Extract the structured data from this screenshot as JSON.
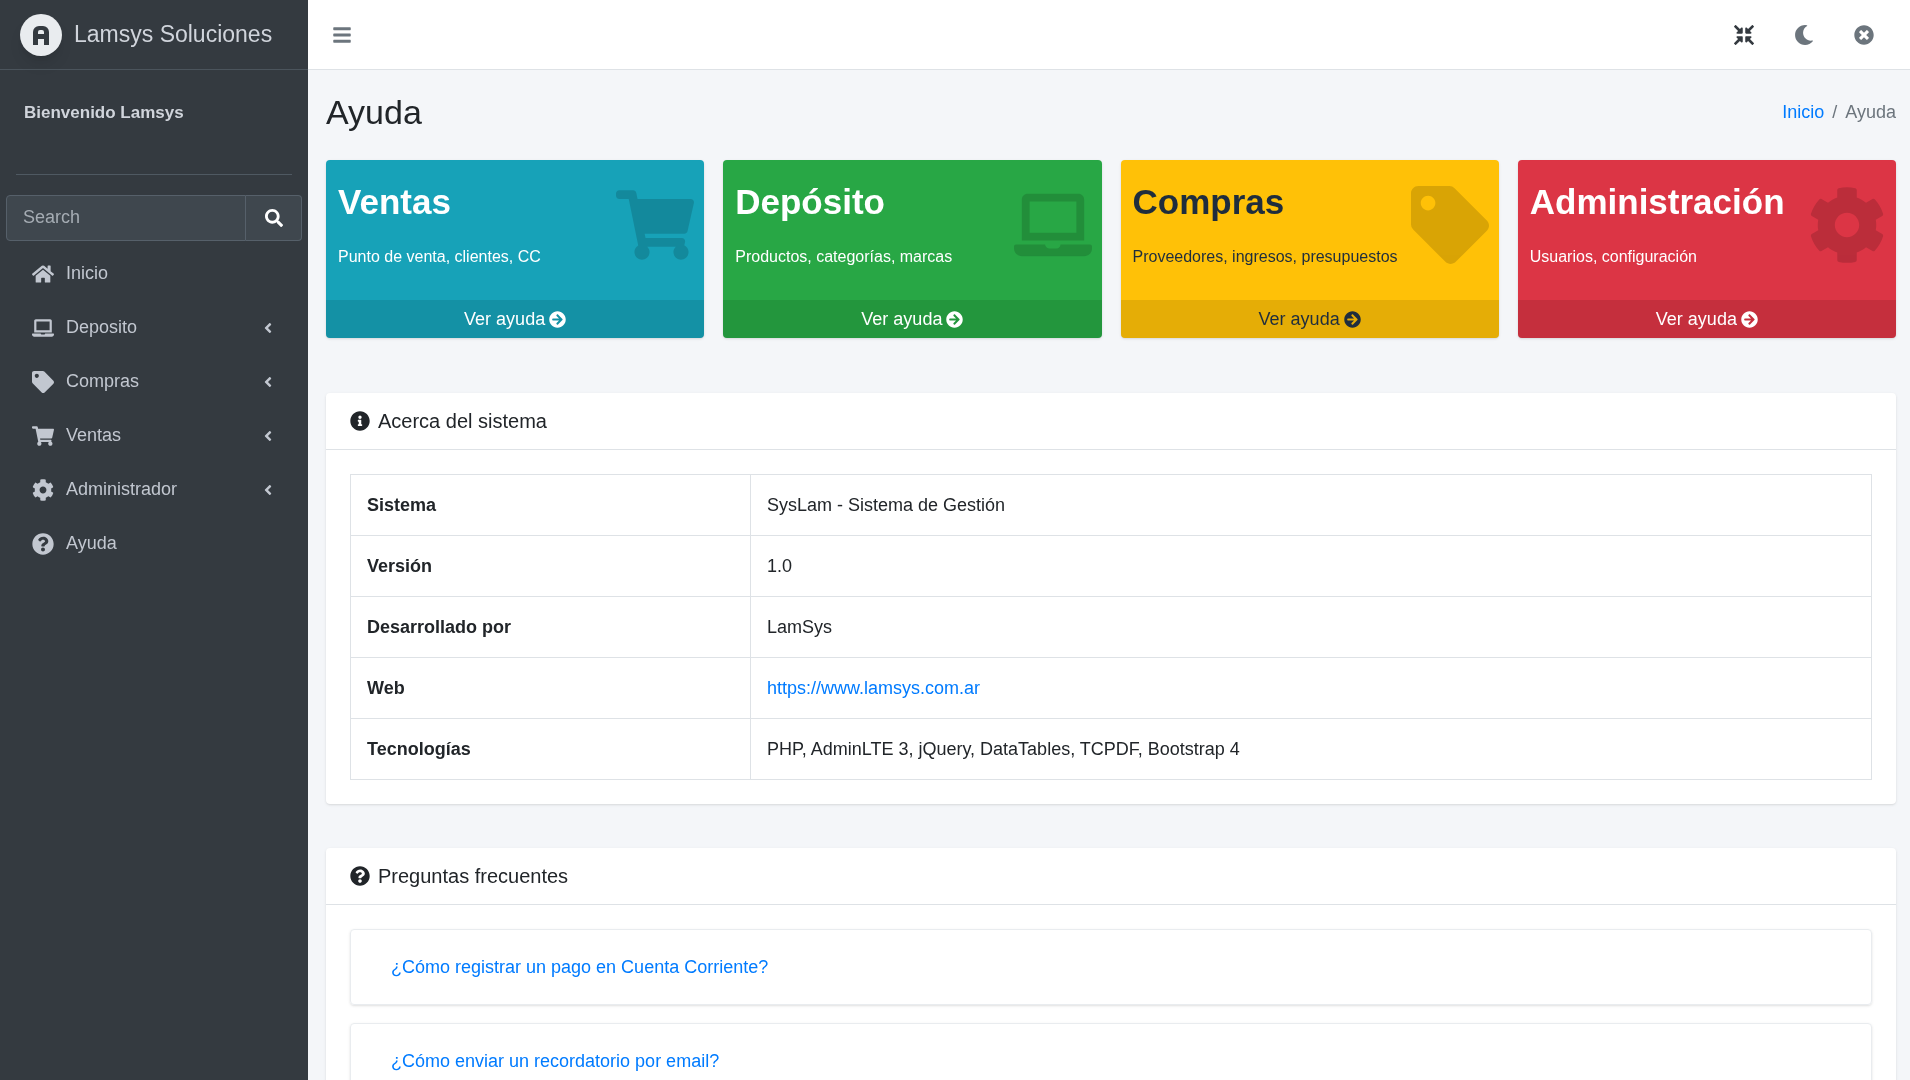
{
  "brand": {
    "title": "Lamsys Soluciones"
  },
  "sidebar": {
    "welcome": "Bienvenido Lamsys",
    "search": {
      "placeholder": "Search"
    },
    "items": [
      {
        "label": "Inicio",
        "has_submenu": false
      },
      {
        "label": "Deposito",
        "has_submenu": true
      },
      {
        "label": "Compras",
        "has_submenu": true
      },
      {
        "label": "Ventas",
        "has_submenu": true
      },
      {
        "label": "Administrador",
        "has_submenu": true
      },
      {
        "label": "Ayuda",
        "has_submenu": false
      }
    ]
  },
  "page": {
    "title": "Ayuda",
    "breadcrumb_separator": "/",
    "breadcrumb": [
      {
        "label": "Inicio",
        "kind": "link"
      },
      {
        "label": "Ayuda",
        "kind": "current"
      }
    ]
  },
  "boxes": [
    {
      "title": "Ventas",
      "subtitle": "Punto de venta, clientes, CC",
      "link": "Ver ayuda",
      "color": "#17a2b8"
    },
    {
      "title": "Depósito",
      "subtitle": "Productos, categorías, marcas",
      "link": "Ver ayuda",
      "color": "#28a745"
    },
    {
      "title": "Compras",
      "subtitle": "Proveedores, ingresos, presupuestos",
      "link": "Ver ayuda",
      "color": "#ffc107"
    },
    {
      "title": "Administración",
      "subtitle": "Usuarios, configuración",
      "link": "Ver ayuda",
      "color": "#dc3545"
    }
  ],
  "about": {
    "title": "Acerca del sistema",
    "rows": [
      {
        "label": "Sistema",
        "value": "SysLam - Sistema de Gestión",
        "kind": "text"
      },
      {
        "label": "Versión",
        "value": "1.0",
        "kind": "text"
      },
      {
        "label": "Desarrollado por",
        "value": "LamSys",
        "kind": "text"
      },
      {
        "label": "Web",
        "value": "https://www.lamsys.com.ar",
        "kind": "link"
      },
      {
        "label": "Tecnologías",
        "value": "PHP, AdminLTE 3, jQuery, DataTables, TCPDF, Bootstrap 4",
        "kind": "text"
      }
    ]
  },
  "faq": {
    "title": "Preguntas frecuentes",
    "items": [
      {
        "question": "¿Cómo registrar un pago en Cuenta Corriente?"
      },
      {
        "question": "¿Cómo enviar un recordatorio por email?"
      }
    ]
  }
}
